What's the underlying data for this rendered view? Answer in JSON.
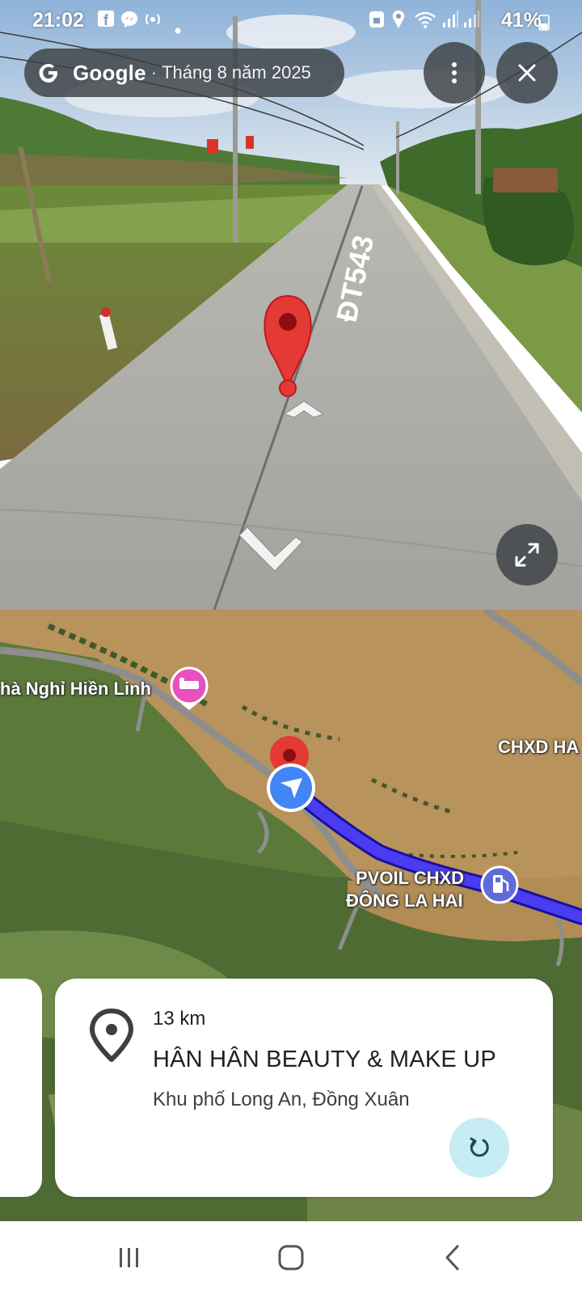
{
  "status_bar": {
    "time": "21:02",
    "battery": "41%",
    "left_icons": [
      "facebook-icon",
      "messenger-icon",
      "hotspot-icon",
      "dot-icon"
    ],
    "right_icons": [
      "vpn-lock-icon",
      "location-icon",
      "wifi-icon",
      "signal-icon",
      "signal-icon",
      "battery-icon"
    ]
  },
  "street_view": {
    "brand": "Google",
    "separator": "·",
    "capture_date": "Tháng 8 năm 2025",
    "road_label": "ĐT543",
    "colors": {
      "overlay": "#3c4043",
      "pin_red": "#e53935"
    }
  },
  "map": {
    "labels": {
      "guesthouse": "hà Nghỉ Hiền Linh",
      "gas_station_1": "CHXD HA",
      "gas_station_2_line1": "PVOIL CHXD",
      "gas_station_2_line2": "ĐÔNG LA HAI"
    },
    "colors": {
      "route": "#4a3cf0",
      "location_blue": "#4285f4",
      "hotel_pink": "#e84fc0",
      "gas_blue": "#5e6bd8"
    }
  },
  "place_card": {
    "distance": "13 km",
    "name": "HÂN HÂN BEAUTY & MAKE UP",
    "address": "Khu phố Long An, Đồng Xuân"
  }
}
